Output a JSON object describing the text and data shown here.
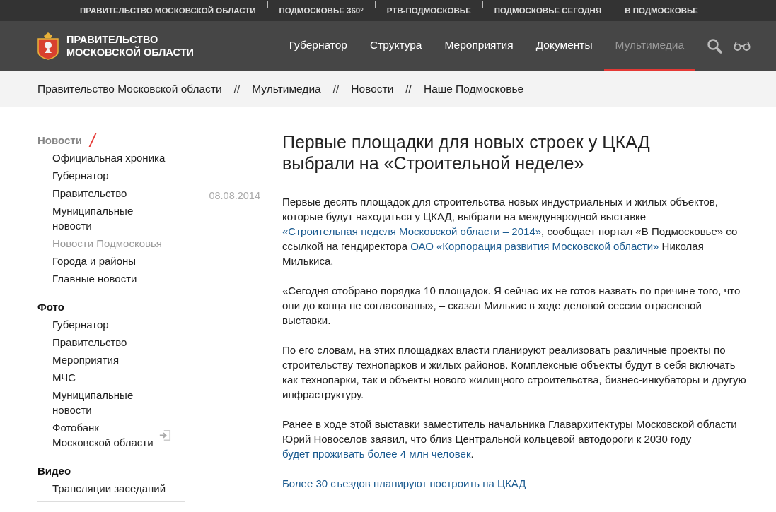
{
  "top_links": [
    {
      "label": "ПРАВИТЕЛЬСТВО МОСКОВСКОЙ ОБЛАСТИ"
    },
    {
      "label": "ПОДМОСКОВЬЕ 360°"
    },
    {
      "label": "РТВ-ПОДМОСКОВЬЕ"
    },
    {
      "label": "ПОДМОСКОВЬЕ СЕГОДНЯ"
    },
    {
      "label": "В ПОДМОСКОВЬЕ"
    }
  ],
  "header": {
    "logo_lines": [
      "ПРАВИТЕЛЬСТВО",
      "МОСКОВСКОЙ ОБЛАСТИ"
    ],
    "nav": [
      {
        "label": "Губернатор",
        "selected": false
      },
      {
        "label": "Структура",
        "selected": false
      },
      {
        "label": "Мероприятия",
        "selected": false
      },
      {
        "label": "Документы",
        "selected": false
      },
      {
        "label": "Мультимедиа",
        "selected": true
      }
    ]
  },
  "breadcrumbs": {
    "items": [
      "Правительство Московской области",
      "Мультимедиа",
      "Новости",
      "Наше Подмосковье"
    ],
    "separator": "//"
  },
  "sidebar": {
    "sections": [
      {
        "title": "Новости",
        "selected": true,
        "items": [
          {
            "label": "Официальная хроника",
            "selected": false
          },
          {
            "label": "Губернатор",
            "selected": false
          },
          {
            "label": "Правительство",
            "selected": false
          },
          {
            "label": "Муниципальные новости",
            "selected": false
          },
          {
            "label": "Новости Подмосковья",
            "selected": true
          },
          {
            "label": "Города и районы",
            "selected": false
          },
          {
            "label": "Главные новости",
            "selected": false
          }
        ]
      },
      {
        "title": "Фото",
        "selected": false,
        "items": [
          {
            "label": "Губернатор",
            "selected": false
          },
          {
            "label": "Правительство",
            "selected": false
          },
          {
            "label": "Мероприятия",
            "selected": false
          },
          {
            "label": "МЧС",
            "selected": false
          },
          {
            "label": "Муниципальные новости",
            "selected": false
          },
          {
            "label": "Фотобанк Московской области",
            "selected": false,
            "external": true
          }
        ]
      },
      {
        "title": "Видео",
        "selected": false,
        "items": [
          {
            "label": "Трансляции заседаний",
            "selected": false
          }
        ]
      }
    ]
  },
  "article": {
    "date": "08.08.2014",
    "title": "Первые площадки для новых строек у ЦКАД выбрали на «Строительной неделе»",
    "paragraphs": [
      [
        {
          "text": "Первые десять площадок для строительства новых индустриальных и жилых объектов, которые будут находиться у ЦКАД, выбрали на международной выставке "
        },
        {
          "text": "«Строительная неделя Московской области – 2014»",
          "link": true
        },
        {
          "text": ", сообщает портал «В Подмосковье» со ссылкой на гендиректора "
        },
        {
          "text": "ОАО «Корпорация развития Московской области»",
          "link": true
        },
        {
          "text": " Николая Милькиса."
        }
      ],
      [
        {
          "text": "«Сегодня отобрано порядка 10 площадок. Я сейчас их не готов назвать по причине того, что они до конца не согласованы», – сказал Милькис в ходе деловой сессии отраслевой выставки."
        }
      ],
      [
        {
          "text": "По его словам, на этих площадках власти планируют реализовать различные проекты по строительству технопарков и жилых районов. Комплексные объекты будут в себя включать как технопарки, так и объекты нового жилищного строительства, бизнес-инкубаторы и другую инфраструктуру."
        }
      ],
      [
        {
          "text": "Ранее в ходе этой выставки заместитель начальника Главархитектуры Московской области Юрий Новоселов заявил, что близ Центральной кольцевой автодороги к 2030 году "
        },
        {
          "text": "будет проживать более 4 млн человек",
          "link": true
        },
        {
          "text": "."
        }
      ],
      [
        {
          "text": "Более 30 съездов планируют построить на ЦКАД",
          "link": true
        }
      ]
    ]
  }
}
